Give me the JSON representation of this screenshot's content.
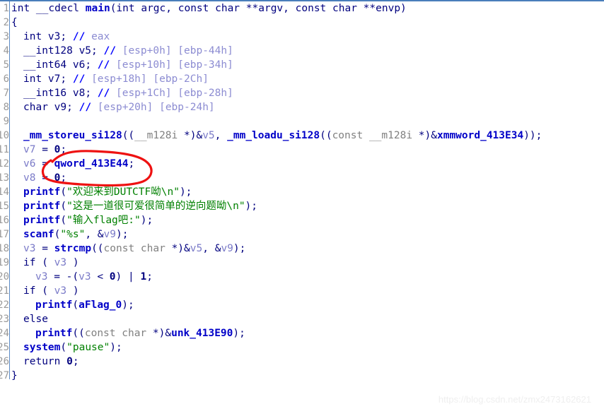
{
  "window": {
    "kind": "ida-pseudocode-view",
    "background": "#ffffff",
    "rule_color": "#4a7ebb",
    "gutter_rule_color": "#5b8ac4"
  },
  "watermark": {
    "text": "https://blog.csdn.net/zmx2473162621"
  },
  "annotation": {
    "name": "red-circle",
    "color": "#ee1111",
    "target_text": "qword_413E44;"
  },
  "palette": {
    "keyword": "#00007f",
    "function": "#0000c8",
    "variable": "#7b7bc8",
    "string": "#008000",
    "comment_marker": "#0000ff",
    "comment_text": "#8c8cd2",
    "cast_type": "#808080",
    "lineno": "#9a9a9a"
  },
  "editor": {
    "first_line": 1,
    "last_line": 27,
    "line_height": 20,
    "line_numbers": [
      "1",
      "2",
      "3",
      "4",
      "5",
      "6",
      "7",
      "8",
      "9",
      "10",
      "11",
      "12",
      "13",
      "14",
      "15",
      "16",
      "17",
      "18",
      "19",
      "20",
      "21",
      "22",
      "23",
      "24",
      "25",
      "26",
      "27"
    ],
    "lines": [
      {
        "n": "1",
        "indent": 0,
        "tokens": [
          {
            "t": "int ",
            "c": "kw"
          },
          {
            "t": "__cdecl ",
            "c": "kw"
          },
          {
            "t": "main",
            "c": "fn"
          },
          {
            "t": "(",
            "c": "punct"
          },
          {
            "t": "int ",
            "c": "kw"
          },
          {
            "t": "argc",
            "c": "plain"
          },
          {
            "t": ", ",
            "c": "punct"
          },
          {
            "t": "const char ",
            "c": "kw"
          },
          {
            "t": "**",
            "c": "punct"
          },
          {
            "t": "argv",
            "c": "plain"
          },
          {
            "t": ", ",
            "c": "punct"
          },
          {
            "t": "const char ",
            "c": "kw"
          },
          {
            "t": "**",
            "c": "punct"
          },
          {
            "t": "envp",
            "c": "plain"
          },
          {
            "t": ")",
            "c": "punct"
          }
        ]
      },
      {
        "n": "2",
        "indent": 0,
        "tokens": [
          {
            "t": "{",
            "c": "punct"
          }
        ]
      },
      {
        "n": "3",
        "indent": 1,
        "tokens": [
          {
            "t": "int ",
            "c": "kw"
          },
          {
            "t": "v3",
            "c": "plain"
          },
          {
            "t": "; ",
            "c": "punct"
          },
          {
            "t": "// ",
            "c": "comment"
          },
          {
            "t": "eax",
            "c": "cmt"
          }
        ]
      },
      {
        "n": "4",
        "indent": 1,
        "tokens": [
          {
            "t": "__int128 ",
            "c": "kw"
          },
          {
            "t": "v5",
            "c": "plain"
          },
          {
            "t": "; ",
            "c": "punct"
          },
          {
            "t": "// ",
            "c": "comment"
          },
          {
            "t": "[esp+0h] [ebp-44h]",
            "c": "cmt"
          }
        ]
      },
      {
        "n": "5",
        "indent": 1,
        "tokens": [
          {
            "t": "__int64 ",
            "c": "kw"
          },
          {
            "t": "v6",
            "c": "plain"
          },
          {
            "t": "; ",
            "c": "punct"
          },
          {
            "t": "// ",
            "c": "comment"
          },
          {
            "t": "[esp+10h] [ebp-34h]",
            "c": "cmt"
          }
        ]
      },
      {
        "n": "6",
        "indent": 1,
        "tokens": [
          {
            "t": "int ",
            "c": "kw"
          },
          {
            "t": "v7",
            "c": "plain"
          },
          {
            "t": "; ",
            "c": "punct"
          },
          {
            "t": "// ",
            "c": "comment"
          },
          {
            "t": "[esp+18h] [ebp-2Ch]",
            "c": "cmt"
          }
        ]
      },
      {
        "n": "7",
        "indent": 1,
        "tokens": [
          {
            "t": "__int16 ",
            "c": "kw"
          },
          {
            "t": "v8",
            "c": "plain"
          },
          {
            "t": "; ",
            "c": "punct"
          },
          {
            "t": "// ",
            "c": "comment"
          },
          {
            "t": "[esp+1Ch] [ebp-28h]",
            "c": "cmt"
          }
        ]
      },
      {
        "n": "8",
        "indent": 1,
        "tokens": [
          {
            "t": "char ",
            "c": "kw"
          },
          {
            "t": "v9",
            "c": "plain"
          },
          {
            "t": "; ",
            "c": "punct"
          },
          {
            "t": "// ",
            "c": "comment"
          },
          {
            "t": "[esp+20h] [ebp-24h]",
            "c": "cmt"
          }
        ]
      },
      {
        "n": "9",
        "indent": 0,
        "tokens": []
      },
      {
        "n": "10",
        "indent": 1,
        "tokens": [
          {
            "t": "_mm_storeu_si128",
            "c": "fn"
          },
          {
            "t": "((",
            "c": "punct"
          },
          {
            "t": "__m128i ",
            "c": "type"
          },
          {
            "t": "*)&",
            "c": "punct"
          },
          {
            "t": "v5",
            "c": "var"
          },
          {
            "t": ", ",
            "c": "punct"
          },
          {
            "t": "_mm_loadu_si128",
            "c": "fn"
          },
          {
            "t": "((",
            "c": "punct"
          },
          {
            "t": "const __m128i ",
            "c": "type"
          },
          {
            "t": "*)&",
            "c": "punct"
          },
          {
            "t": "xmmword_413E34",
            "c": "global"
          },
          {
            "t": "));",
            "c": "punct"
          }
        ]
      },
      {
        "n": "11",
        "indent": 1,
        "tokens": [
          {
            "t": "v7",
            "c": "var"
          },
          {
            "t": " = ",
            "c": "punct"
          },
          {
            "t": "0",
            "c": "num"
          },
          {
            "t": ";",
            "c": "punct"
          }
        ]
      },
      {
        "n": "12",
        "indent": 1,
        "tokens": [
          {
            "t": "v6",
            "c": "var"
          },
          {
            "t": " = ",
            "c": "punct"
          },
          {
            "t": "qword_413E44",
            "c": "global"
          },
          {
            "t": ";",
            "c": "punct"
          }
        ]
      },
      {
        "n": "13",
        "indent": 1,
        "tokens": [
          {
            "t": "v8",
            "c": "var"
          },
          {
            "t": " = ",
            "c": "punct"
          },
          {
            "t": "0",
            "c": "num"
          },
          {
            "t": ";",
            "c": "punct"
          }
        ]
      },
      {
        "n": "14",
        "indent": 1,
        "tokens": [
          {
            "t": "printf",
            "c": "fn"
          },
          {
            "t": "(",
            "c": "punct"
          },
          {
            "t": "\"欢迎来到DUTCTF呦\\n\"",
            "c": "str"
          },
          {
            "t": ");",
            "c": "punct"
          }
        ]
      },
      {
        "n": "15",
        "indent": 1,
        "tokens": [
          {
            "t": "printf",
            "c": "fn"
          },
          {
            "t": "(",
            "c": "punct"
          },
          {
            "t": "\"这是一道很可爱很简单的逆向题呦\\n\"",
            "c": "str"
          },
          {
            "t": ");",
            "c": "punct"
          }
        ]
      },
      {
        "n": "16",
        "indent": 1,
        "tokens": [
          {
            "t": "printf",
            "c": "fn"
          },
          {
            "t": "(",
            "c": "punct"
          },
          {
            "t": "\"输入flag吧:\"",
            "c": "str"
          },
          {
            "t": ");",
            "c": "punct"
          }
        ]
      },
      {
        "n": "17",
        "indent": 1,
        "tokens": [
          {
            "t": "scanf",
            "c": "fn"
          },
          {
            "t": "(",
            "c": "punct"
          },
          {
            "t": "\"%s\"",
            "c": "str"
          },
          {
            "t": ", &",
            "c": "punct"
          },
          {
            "t": "v9",
            "c": "var"
          },
          {
            "t": ");",
            "c": "punct"
          }
        ]
      },
      {
        "n": "18",
        "indent": 1,
        "tokens": [
          {
            "t": "v3",
            "c": "var"
          },
          {
            "t": " = ",
            "c": "punct"
          },
          {
            "t": "strcmp",
            "c": "fn"
          },
          {
            "t": "((",
            "c": "punct"
          },
          {
            "t": "const char ",
            "c": "type"
          },
          {
            "t": "*)&",
            "c": "punct"
          },
          {
            "t": "v5",
            "c": "var"
          },
          {
            "t": ", &",
            "c": "punct"
          },
          {
            "t": "v9",
            "c": "var"
          },
          {
            "t": ");",
            "c": "punct"
          }
        ]
      },
      {
        "n": "19",
        "indent": 1,
        "tokens": [
          {
            "t": "if ",
            "c": "kw"
          },
          {
            "t": "( ",
            "c": "punct"
          },
          {
            "t": "v3",
            "c": "var"
          },
          {
            "t": " )",
            "c": "punct"
          }
        ]
      },
      {
        "n": "20",
        "indent": 2,
        "tokens": [
          {
            "t": "v3",
            "c": "var"
          },
          {
            "t": " = -(",
            "c": "punct"
          },
          {
            "t": "v3",
            "c": "var"
          },
          {
            "t": " < ",
            "c": "punct"
          },
          {
            "t": "0",
            "c": "num"
          },
          {
            "t": ") | ",
            "c": "punct"
          },
          {
            "t": "1",
            "c": "num"
          },
          {
            "t": ";",
            "c": "punct"
          }
        ]
      },
      {
        "n": "21",
        "indent": 1,
        "tokens": [
          {
            "t": "if ",
            "c": "kw"
          },
          {
            "t": "( ",
            "c": "punct"
          },
          {
            "t": "v3",
            "c": "var"
          },
          {
            "t": " )",
            "c": "punct"
          }
        ]
      },
      {
        "n": "22",
        "indent": 2,
        "tokens": [
          {
            "t": "printf",
            "c": "fn"
          },
          {
            "t": "(",
            "c": "punct"
          },
          {
            "t": "aFlag_0",
            "c": "global"
          },
          {
            "t": ");",
            "c": "punct"
          }
        ]
      },
      {
        "n": "23",
        "indent": 1,
        "tokens": [
          {
            "t": "else",
            "c": "kw"
          }
        ]
      },
      {
        "n": "24",
        "indent": 2,
        "tokens": [
          {
            "t": "printf",
            "c": "fn"
          },
          {
            "t": "((",
            "c": "punct"
          },
          {
            "t": "const char ",
            "c": "type"
          },
          {
            "t": "*)&",
            "c": "punct"
          },
          {
            "t": "unk_413E90",
            "c": "global"
          },
          {
            "t": ");",
            "c": "punct"
          }
        ]
      },
      {
        "n": "25",
        "indent": 1,
        "tokens": [
          {
            "t": "system",
            "c": "fn"
          },
          {
            "t": "(",
            "c": "punct"
          },
          {
            "t": "\"pause\"",
            "c": "str"
          },
          {
            "t": ");",
            "c": "punct"
          }
        ]
      },
      {
        "n": "26",
        "indent": 1,
        "tokens": [
          {
            "t": "return ",
            "c": "kw"
          },
          {
            "t": "0",
            "c": "num"
          },
          {
            "t": ";",
            "c": "punct"
          }
        ]
      },
      {
        "n": "27",
        "indent": 0,
        "tokens": [
          {
            "t": "}",
            "c": "punct"
          }
        ]
      }
    ]
  }
}
